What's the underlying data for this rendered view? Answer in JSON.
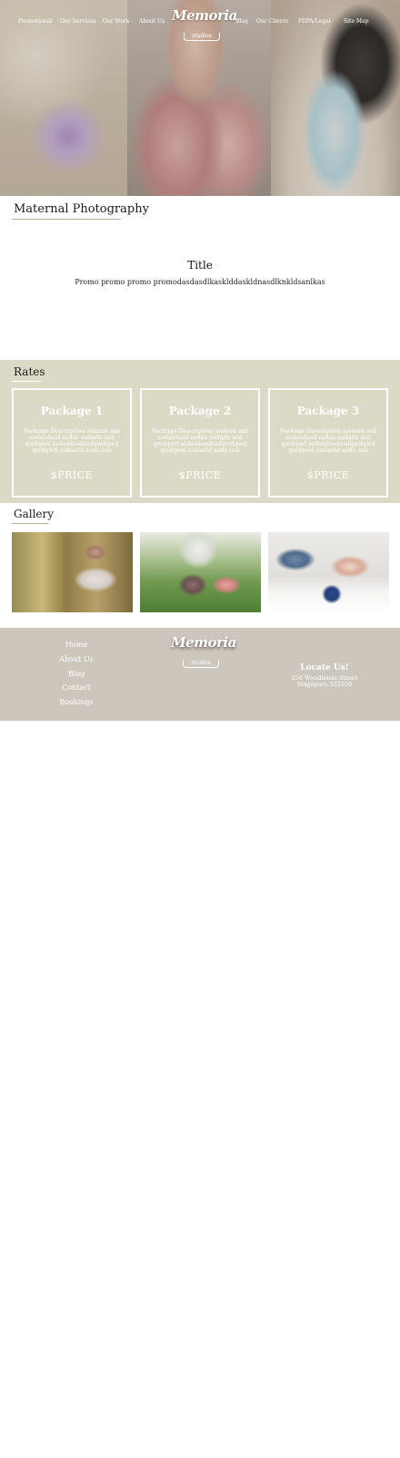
{
  "nav": {
    "left": [
      "Promotional",
      "Our Services",
      "Our Work",
      "About Us"
    ],
    "right": [
      "Blog",
      "Our Clients",
      "PDPA/Legal",
      "Site Map"
    ]
  },
  "logo": {
    "main": "Memoria",
    "sub": "studios"
  },
  "page_heading": "Maternal Photography",
  "promo": {
    "title": "Title",
    "text": "Promo promo promo promodasdasdlkasklddaskldnasdlknkldsanlkas"
  },
  "rates": {
    "heading": "Rates",
    "packages": [
      {
        "name": "Package 1",
        "description": "Package Description asdasd asd asdasdasd asdas asdqdx asd qwdqwd asdasdasdasdqwdqwd qwdqwd asdasdd asda asb",
        "price": "$PRICE"
      },
      {
        "name": "Package 2",
        "description": "Package Description asdasd asd asdasdasd asdas asdqdx asd qwdqwd asdasdasdasdqwdqwd qwdqwd asdasdd asda asb",
        "price": "$PRICE"
      },
      {
        "name": "Package 3",
        "description": "Package Description asdasd asd asdasdasd asdas asdqdx asd qwdqwd asdasdasdasdqwdqwd qwdqwd asdasdd asda asb",
        "price": "$PRICE"
      }
    ]
  },
  "gallery": {
    "heading": "Gallery"
  },
  "footer": {
    "links": [
      "Home",
      "About Us",
      "Blog",
      "Contact",
      "Bookings"
    ],
    "locate_title": "Locate Us!",
    "address_line1": "256 Woodlands Street",
    "address_line2": "Singapore 532256"
  },
  "colors": {
    "rates_bg": "#dcd9c6",
    "footer_bg": "#cdc6bc",
    "heading_underline": "#b8ae96"
  }
}
